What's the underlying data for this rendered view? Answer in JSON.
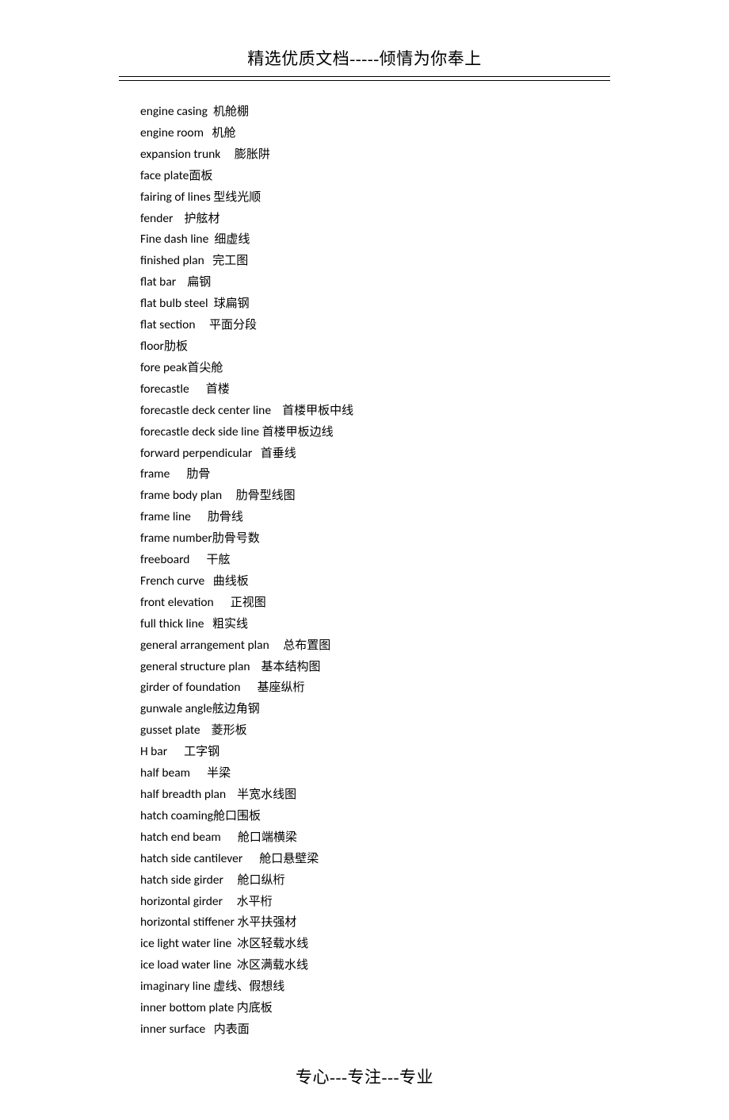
{
  "header": "精选优质文档-----倾情为你奉上",
  "footer": "专心---专注---专业",
  "entries": [
    {
      "en": "engine casing",
      "cn": "机舱棚",
      "gap": "  "
    },
    {
      "en": "engine room",
      "cn": "机舱",
      "gap": "   "
    },
    {
      "en": "expansion trunk",
      "cn": "膨胀阱",
      "gap": "     "
    },
    {
      "en": "face plate",
      "cn": "面板",
      "gap": ""
    },
    {
      "en": "fairing of lines",
      "cn": "型线光顺",
      "gap": " "
    },
    {
      "en": "fender",
      "cn": "护舷材",
      "gap": "    "
    },
    {
      "en": "Fine dash line",
      "cn": "细虚线",
      "gap": "  "
    },
    {
      "en": "finished plan",
      "cn": "完工图",
      "gap": "   "
    },
    {
      "en": "flat bar",
      "cn": "扁钢",
      "gap": "    "
    },
    {
      "en": "flat bulb steel",
      "cn": "球扁钢",
      "gap": "  "
    },
    {
      "en": "flat section",
      "cn": "平面分段",
      "gap": "     "
    },
    {
      "en": "floor",
      "cn": "肋板",
      "gap": ""
    },
    {
      "en": "fore peak",
      "cn": "首尖舱",
      "gap": ""
    },
    {
      "en": "forecastle",
      "cn": "首楼",
      "gap": "      "
    },
    {
      "en": "forecastle deck center line",
      "cn": "首楼甲板中线",
      "gap": "    "
    },
    {
      "en": "forecastle deck side line",
      "cn": "首楼甲板边线",
      "gap": " "
    },
    {
      "en": "forward perpendicular",
      "cn": "首垂线",
      "gap": "   "
    },
    {
      "en": "frame",
      "cn": "肋骨",
      "gap": "      "
    },
    {
      "en": "frame body plan",
      "cn": "肋骨型线图",
      "gap": "     "
    },
    {
      "en": "frame line",
      "cn": "肋骨线",
      "gap": "      "
    },
    {
      "en": "frame number",
      "cn": "肋骨号数",
      "gap": ""
    },
    {
      "en": "freeboard",
      "cn": "干舷",
      "gap": "      "
    },
    {
      "en": "French curve",
      "cn": "曲线板",
      "gap": "   "
    },
    {
      "en": "front elevation",
      "cn": "正视图",
      "gap": "      "
    },
    {
      "en": "full thick line",
      "cn": "粗实线",
      "gap": "   "
    },
    {
      "en": "general arrangement plan",
      "cn": "总布置图",
      "gap": "     "
    },
    {
      "en": "general structure plan",
      "cn": "基本结构图",
      "gap": "    "
    },
    {
      "en": "girder of foundation",
      "cn": "基座纵桁",
      "gap": "      "
    },
    {
      "en": "gunwale angle",
      "cn": "舷边角钢",
      "gap": ""
    },
    {
      "en": "gusset plate",
      "cn": "菱形板",
      "gap": "    "
    },
    {
      "en": "H bar",
      "cn": "工字钢",
      "gap": "      "
    },
    {
      "en": "half beam",
      "cn": "半梁",
      "gap": "      "
    },
    {
      "en": "half breadth plan",
      "cn": "半宽水线图",
      "gap": "    "
    },
    {
      "en": "hatch coaming",
      "cn": "舱口围板",
      "gap": ""
    },
    {
      "en": "hatch end beam",
      "cn": "舱口端横梁",
      "gap": "      "
    },
    {
      "en": "hatch side cantilever",
      "cn": "舱口悬壁梁",
      "gap": "      "
    },
    {
      "en": "hatch side girder",
      "cn": "舱口纵桁",
      "gap": "     "
    },
    {
      "en": "horizontal girder",
      "cn": "水平桁",
      "gap": "     "
    },
    {
      "en": "horizontal stiffener",
      "cn": "水平扶强材",
      "gap": " "
    },
    {
      "en": "ice light water line",
      "cn": "冰区轻载水线",
      "gap": "  "
    },
    {
      "en": "ice load water line",
      "cn": "冰区满载水线",
      "gap": "  "
    },
    {
      "en": "imaginary line",
      "cn": "虚线、假想线",
      "gap": " "
    },
    {
      "en": "inner bottom plate",
      "cn": "内底板",
      "gap": " "
    },
    {
      "en": "inner surface",
      "cn": "内表面",
      "gap": "   "
    }
  ]
}
